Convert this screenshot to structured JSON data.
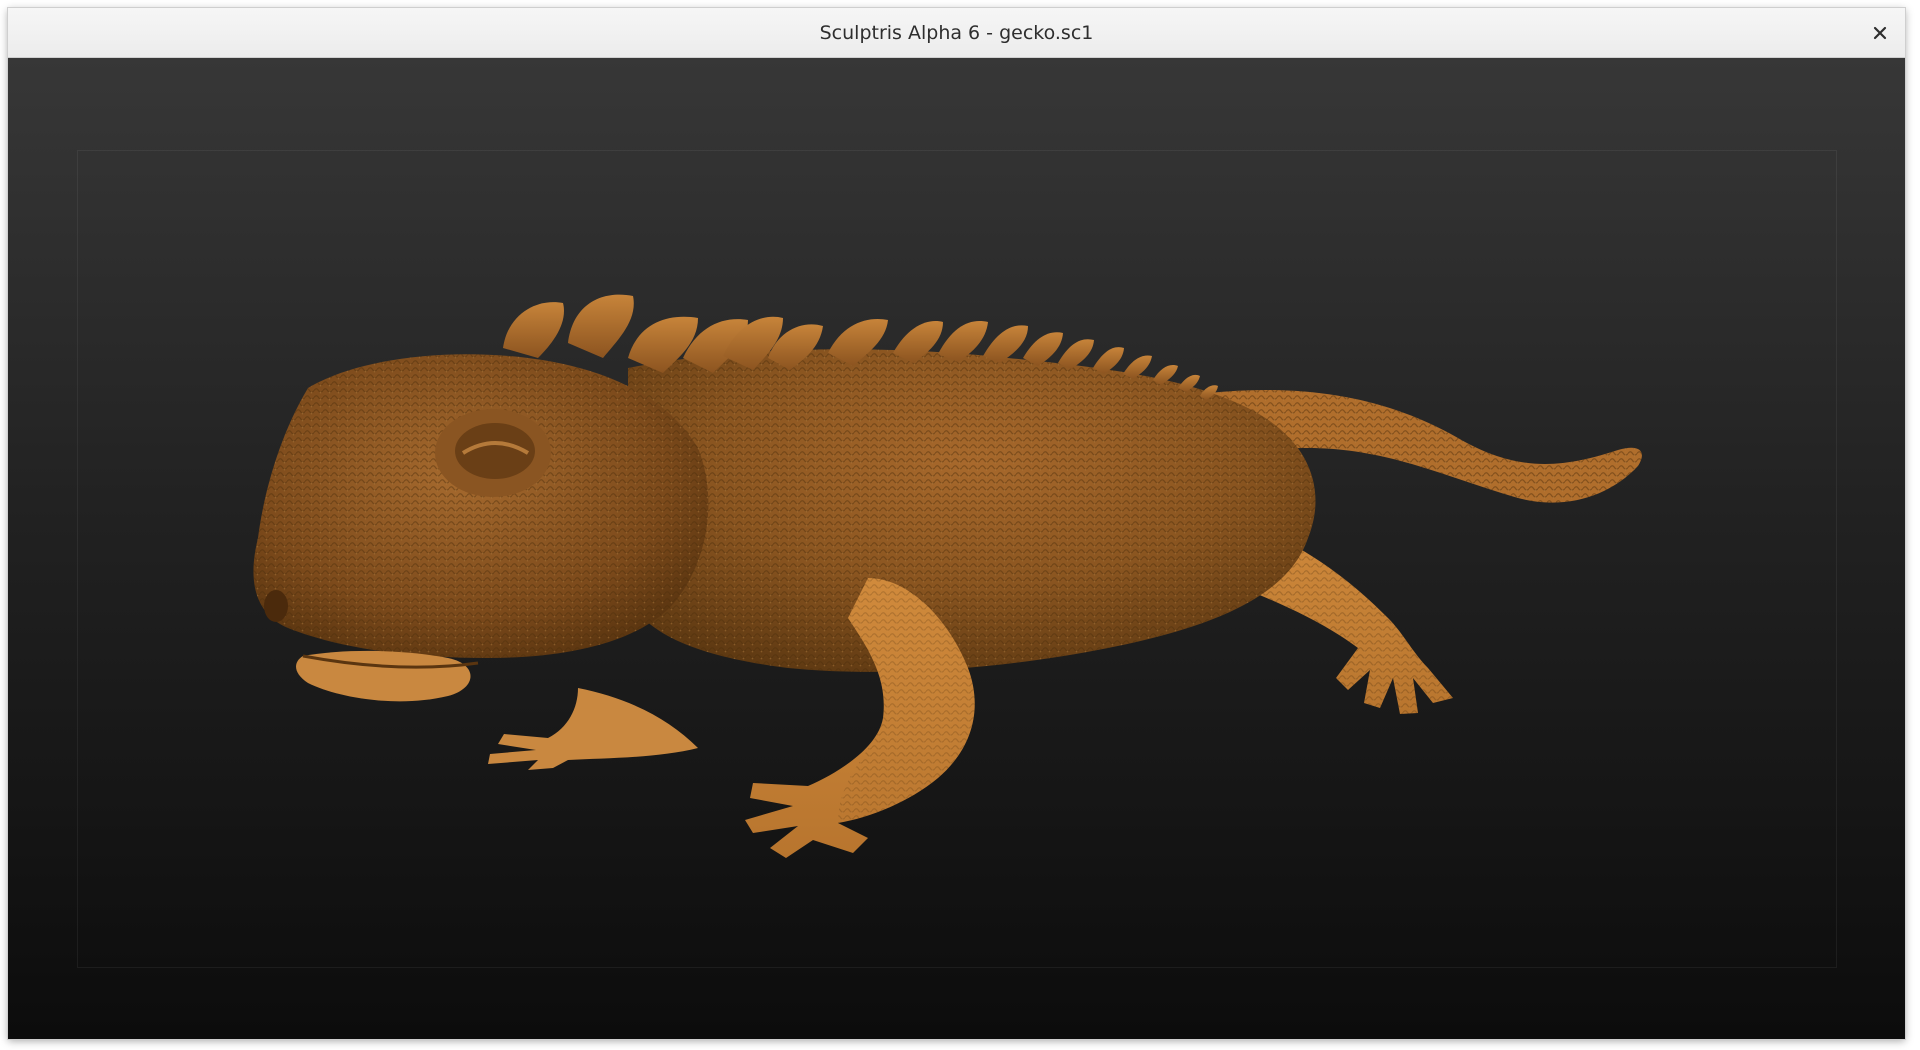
{
  "window": {
    "title": "Sculptris Alpha 6 - gecko.sc1"
  },
  "titlebar": {
    "close_icon": "close-icon"
  },
  "viewport": {
    "model_name": "gecko",
    "model_color": "#b8752e",
    "background_top": "#373737",
    "background_bottom": "#0c0c0c"
  }
}
